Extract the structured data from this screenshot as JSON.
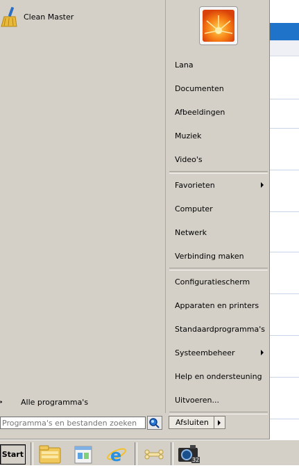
{
  "start_menu": {
    "pinned_programs": [
      {
        "label": "Clean Master",
        "icon": "broom-icon"
      }
    ],
    "all_programs_label": "Alle programma's",
    "search": {
      "placeholder": "Programma's en bestanden zoeken",
      "value": ""
    },
    "right_items_group1": [
      "Lana",
      "Documenten",
      "Afbeeldingen",
      "Muziek",
      "Video's"
    ],
    "right_items_group2": [
      "Favorieten",
      "Computer",
      "Netwerk",
      "Verbinding maken"
    ],
    "right_items_group3": [
      "Configuratiescherm",
      "Apparaten en printers",
      "Standaardprogramma's",
      "Systeembeheer",
      "Help en ondersteuning",
      "Uitvoeren..."
    ],
    "shutdown_label": "Afsluiten"
  },
  "taskbar": {
    "start_label": "Start",
    "icons": [
      "folder-icon",
      "printer-window-icon",
      "internet-explorer-icon",
      "bone-icon",
      "camera-icon"
    ],
    "camera_badge": "32"
  },
  "colors": {
    "menu_bg": "#d4d0c8",
    "accent_blue": "#1f73c8"
  }
}
